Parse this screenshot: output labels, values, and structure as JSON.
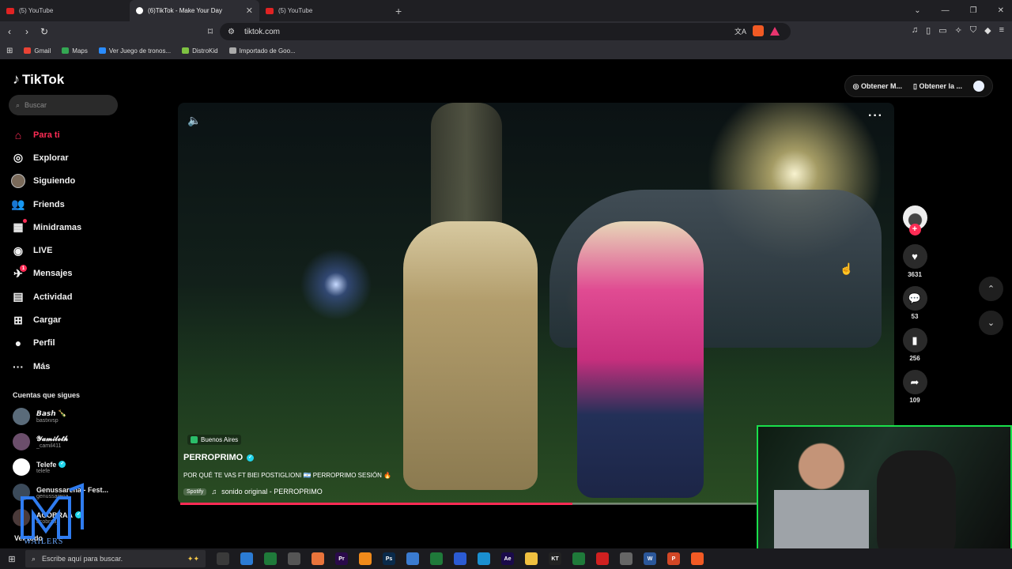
{
  "browser": {
    "tabs": [
      {
        "label": "(5) YouTube",
        "icon": "youtube-icon",
        "active": false
      },
      {
        "label": "(6)TikTok - Make Your Day",
        "icon": "tiktok-icon",
        "active": true
      },
      {
        "label": "(5) YouTube",
        "icon": "youtube-icon",
        "active": false
      }
    ],
    "url": "tiktok.com",
    "bookmarks": [
      {
        "label": "Gmail",
        "color": "#ea4335"
      },
      {
        "label": "Maps",
        "color": "#34a853"
      },
      {
        "label": "Ver Juego de tronos...",
        "color": "#2a8cff"
      },
      {
        "label": "DistroKid",
        "color": "#7ec242"
      },
      {
        "label": "Importado de Goo...",
        "color": "#aaaaaa"
      }
    ]
  },
  "tiktok": {
    "logo": "TikTok",
    "search_placeholder": "Buscar",
    "nav": [
      {
        "label": "Para ti",
        "icon": "home-icon",
        "glyph": "⌂",
        "active": true
      },
      {
        "label": "Explorar",
        "icon": "compass-icon",
        "glyph": "◎"
      },
      {
        "label": "Siguiendo",
        "icon": "following-avatar-icon",
        "glyph": ""
      },
      {
        "label": "Friends",
        "icon": "friends-icon",
        "glyph": "👥"
      },
      {
        "label": "Minidramas",
        "icon": "minidramas-icon",
        "glyph": "▦",
        "dot": ""
      },
      {
        "label": "LIVE",
        "icon": "live-icon",
        "glyph": "◉"
      },
      {
        "label": "Mensajes",
        "icon": "messages-icon",
        "glyph": "✈",
        "dot": "1"
      },
      {
        "label": "Actividad",
        "icon": "activity-icon",
        "glyph": "▤"
      },
      {
        "label": "Cargar",
        "icon": "upload-icon",
        "glyph": "⊞"
      },
      {
        "label": "Perfil",
        "icon": "profile-icon",
        "glyph": "●"
      },
      {
        "label": "Más",
        "icon": "more-icon",
        "glyph": "···"
      }
    ],
    "following_title": "Cuentas que sigues",
    "following": [
      {
        "name": "𝘽𝙖𝙨𝙝 🍾",
        "handle": "bastxvsp",
        "verified": false
      },
      {
        "name": "𝓨𝓪𝓶𝓲𝓵𝓮𝓽𝓱",
        "handle": "_camil411",
        "verified": false
      },
      {
        "name": "Telefe",
        "handle": "telefe",
        "verified": true
      },
      {
        "name": "Genussarena - Fest...",
        "handle": "genussarena",
        "verified": false
      },
      {
        "name": "ACOBRAA",
        "handle": "acobraa_",
        "verified": true
      }
    ],
    "see_all": "Ver todo",
    "top_buttons": [
      "Obtener M...",
      "Obtener la ..."
    ],
    "video": {
      "location": "Buenos Aires",
      "author": "PERROPRIMO",
      "description": "POR QUÉ TE VAS FT BIEI POSTIGLIONI 🇦🇷 PERROPRIMO SESIÓN 🔥",
      "spotify_label": "Spotify",
      "music": "sonido original - PERROPRIMO",
      "progress": 0.68
    },
    "stats": {
      "likes": "3631",
      "comments": "53",
      "saves": "256",
      "shares": "109"
    }
  },
  "watermark": "WAILERS",
  "taskbar": {
    "search_placeholder": "Escribe aquí para buscar.",
    "apps": [
      {
        "label": "",
        "color": "#3a3a3a"
      },
      {
        "label": "",
        "color": "#2b7bd3"
      },
      {
        "label": "",
        "color": "#1f7a3a"
      },
      {
        "label": "",
        "color": "#555555"
      },
      {
        "label": "",
        "color": "#e8743b"
      },
      {
        "label": "Pr",
        "color": "#2a0a4a"
      },
      {
        "label": "",
        "color": "#f08a1a"
      },
      {
        "label": "Ps",
        "color": "#0a2a4a"
      },
      {
        "label": "",
        "color": "#3a7bd0"
      },
      {
        "label": "",
        "color": "#1f7a3a"
      },
      {
        "label": "",
        "color": "#2b5bd3"
      },
      {
        "label": "",
        "color": "#1a8fd0"
      },
      {
        "label": "Ae",
        "color": "#1a0a4a"
      },
      {
        "label": "",
        "color": "#f0c040"
      },
      {
        "label": "KT",
        "color": "#222222"
      },
      {
        "label": "",
        "color": "#1f7a3a"
      },
      {
        "label": "",
        "color": "#d02020"
      },
      {
        "label": "",
        "color": "#666666"
      },
      {
        "label": "W",
        "color": "#2b579a"
      },
      {
        "label": "P",
        "color": "#d24726"
      },
      {
        "label": "",
        "color": "#f15a24"
      }
    ]
  }
}
